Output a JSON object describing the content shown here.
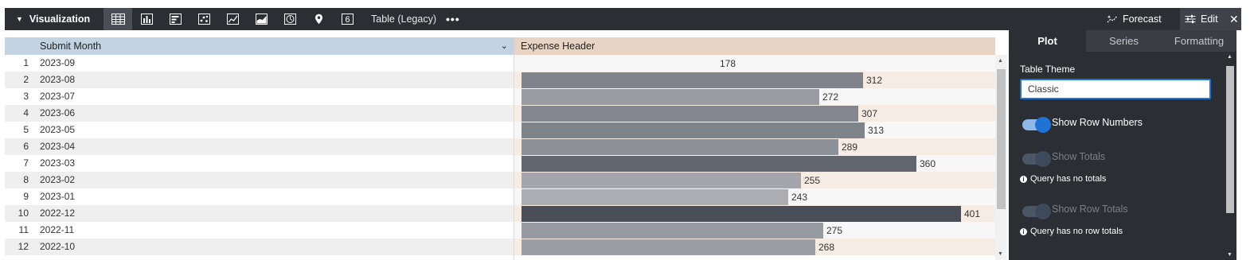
{
  "toolbar": {
    "title": "Visualization",
    "icons": [
      "table-icon",
      "bar-chart-icon",
      "horizontal-bar-icon",
      "scatter-icon",
      "line-chart-icon",
      "area-chart-icon",
      "clock-icon",
      "map-pin-icon",
      "single-value-icon"
    ],
    "single_value_glyph": "6",
    "viz_type_label": "Table (Legacy)",
    "more_label": "•••",
    "forecast_label": "Forecast",
    "edit_label": "Edit",
    "close_label": "✕"
  },
  "table": {
    "dimension_header": "Submit Month",
    "measure_header": "Expense Header",
    "rows": [
      {
        "num": "1",
        "month": "2023-09",
        "value": "178"
      },
      {
        "num": "2",
        "month": "2023-08",
        "value": "312"
      },
      {
        "num": "3",
        "month": "2023-07",
        "value": "272"
      },
      {
        "num": "4",
        "month": "2023-06",
        "value": "307"
      },
      {
        "num": "5",
        "month": "2023-05",
        "value": "313"
      },
      {
        "num": "6",
        "month": "2023-04",
        "value": "289"
      },
      {
        "num": "7",
        "month": "2023-03",
        "value": "360"
      },
      {
        "num": "8",
        "month": "2023-02",
        "value": "255"
      },
      {
        "num": "9",
        "month": "2023-01",
        "value": "243"
      },
      {
        "num": "10",
        "month": "2022-12",
        "value": "401"
      },
      {
        "num": "11",
        "month": "2022-11",
        "value": "275"
      },
      {
        "num": "12",
        "month": "2022-10",
        "value": "268"
      }
    ],
    "colors": {
      "dim_header": "#c3d3e2",
      "measure_header": "#e7d4c4",
      "row_odd": "#ffffff",
      "row_even": "#efefef",
      "measure_odd": "#f7f7f7",
      "measure_even": "#f7ece3",
      "bar_low": "#d4d5d7",
      "bar_high": "#484d58"
    }
  },
  "panel": {
    "tabs": [
      "Plot",
      "Series",
      "Formatting"
    ],
    "active_tab": "Plot",
    "theme_label": "Table Theme",
    "theme_value": "Classic",
    "show_row_numbers_label": "Show Row Numbers",
    "show_row_numbers": true,
    "show_totals_label": "Show Totals",
    "show_totals": false,
    "totals_note": "Query has no totals",
    "show_row_totals_label": "Show Row Totals",
    "show_row_totals": false,
    "row_totals_note": "Query has no row totals",
    "accent": "#1f73d6"
  }
}
